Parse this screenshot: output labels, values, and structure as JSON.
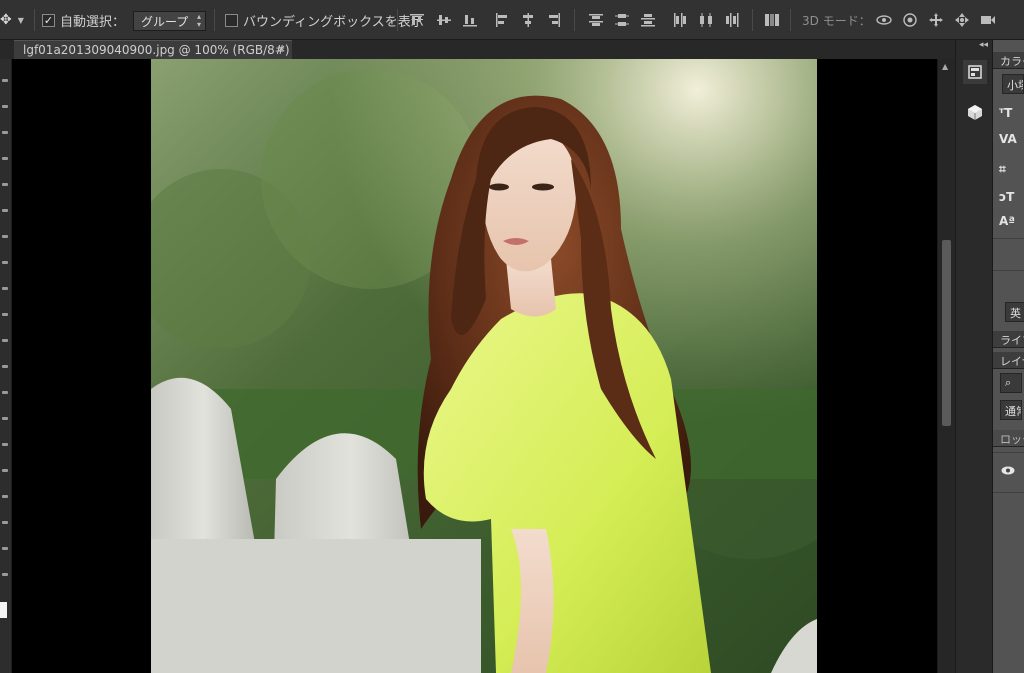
{
  "options_bar": {
    "move_tool_icon": "move-tool-icon",
    "auto_select_label": "自動選択：",
    "auto_select_checked": true,
    "auto_select_target": "グループ",
    "bounding_box_label": "バウンディングボックスを表示",
    "bounding_box_checked": false,
    "mode_3d_label": "3D モード："
  },
  "document": {
    "tab_title": "lgf01a201309040900.jpg @ 100% (RGB/8#)",
    "close_glyph": "×"
  },
  "right_panels": {
    "color_tab": "カラー",
    "small_field": "小塚",
    "lang_field": "英",
    "library_tab": "ライブ",
    "layers_tab": "レイヤ",
    "blend_field": "通常",
    "lock_label": "ロック"
  },
  "colors": {
    "ui_bg": "#282828",
    "options_bg": "#323232",
    "panel_bg": "#535353",
    "canvas_bg": "#000000"
  }
}
